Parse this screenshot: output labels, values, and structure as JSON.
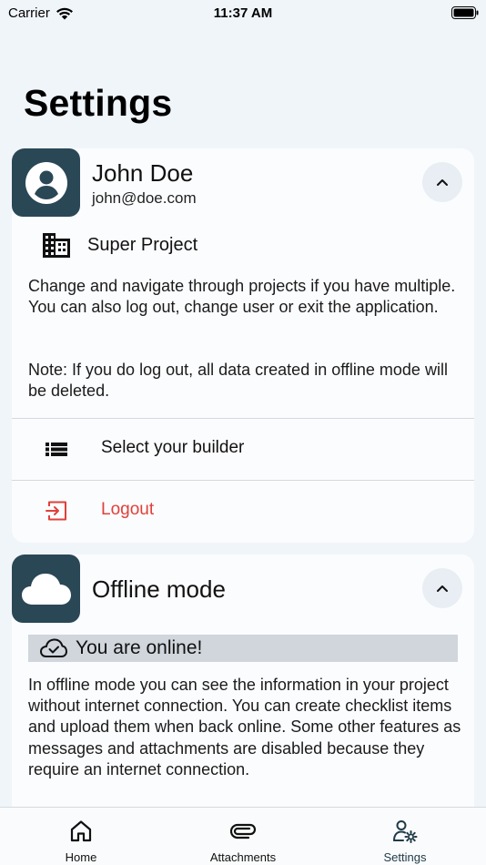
{
  "status_bar": {
    "carrier": "Carrier",
    "time": "11:37 AM"
  },
  "header": {
    "title": "Settings"
  },
  "account_card": {
    "name": "John Doe",
    "email": "john@doe.com",
    "project_name": "Super Project",
    "description": "Change and navigate through projects if you have multiple. You can also log out, change user or exit the application.",
    "note": "Note: If you do log out, all data created in offline mode will be deleted.",
    "actions": [
      {
        "label": "Select your builder",
        "icon": "list-icon",
        "color": "#111111"
      },
      {
        "label": "Logout",
        "icon": "logout-icon",
        "color": "#e0403a"
      }
    ]
  },
  "offline_card": {
    "title": "Offline mode",
    "status": "You are online!",
    "description": "In offline mode you can see the information in your project without internet connection. You can create checklist items and upload them when back online. Some other features as messages and attachments are disabled because they require an internet connection."
  },
  "tab_bar": {
    "tabs": [
      {
        "label": "Home",
        "icon": "home-icon"
      },
      {
        "label": "Attachments",
        "icon": "paperclip-icon"
      },
      {
        "label": "Settings",
        "icon": "user-settings-icon",
        "active": true
      }
    ]
  },
  "colors": {
    "background": "#f0f5fa",
    "card": "#fbfcfe",
    "tile": "#2a4756",
    "danger": "#e0403a",
    "banner": "#d0d6dc"
  }
}
